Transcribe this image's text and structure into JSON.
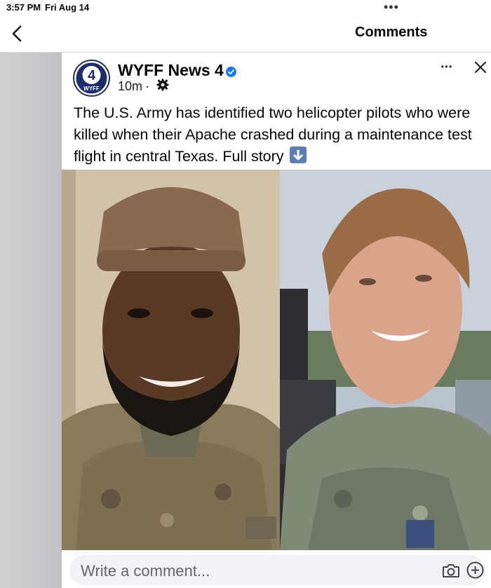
{
  "status_bar": {
    "time": "3:57 PM",
    "date": "Fri Aug 14",
    "dots": "•••"
  },
  "nav": {
    "title": "Comments",
    "back_icon": "chevron-left-icon"
  },
  "post": {
    "page_name": "WYFF News 4",
    "avatar_text": "4",
    "avatar_subtext": "WYFF",
    "time": "10m",
    "meta_separator": "·",
    "privacy_icon": "gear-icon",
    "more_label": "···",
    "text": "The U.S. Army has identified two helicopter pilots who were killed when their Apache crashed during a maintenance test flight in central Texas. Full story",
    "text_icon": "down-arrow-icon",
    "accent_color": "#1877f2"
  },
  "comment_bar": {
    "placeholder": "Write a comment...",
    "icons": [
      "camera-icon",
      "plus-icon"
    ]
  }
}
